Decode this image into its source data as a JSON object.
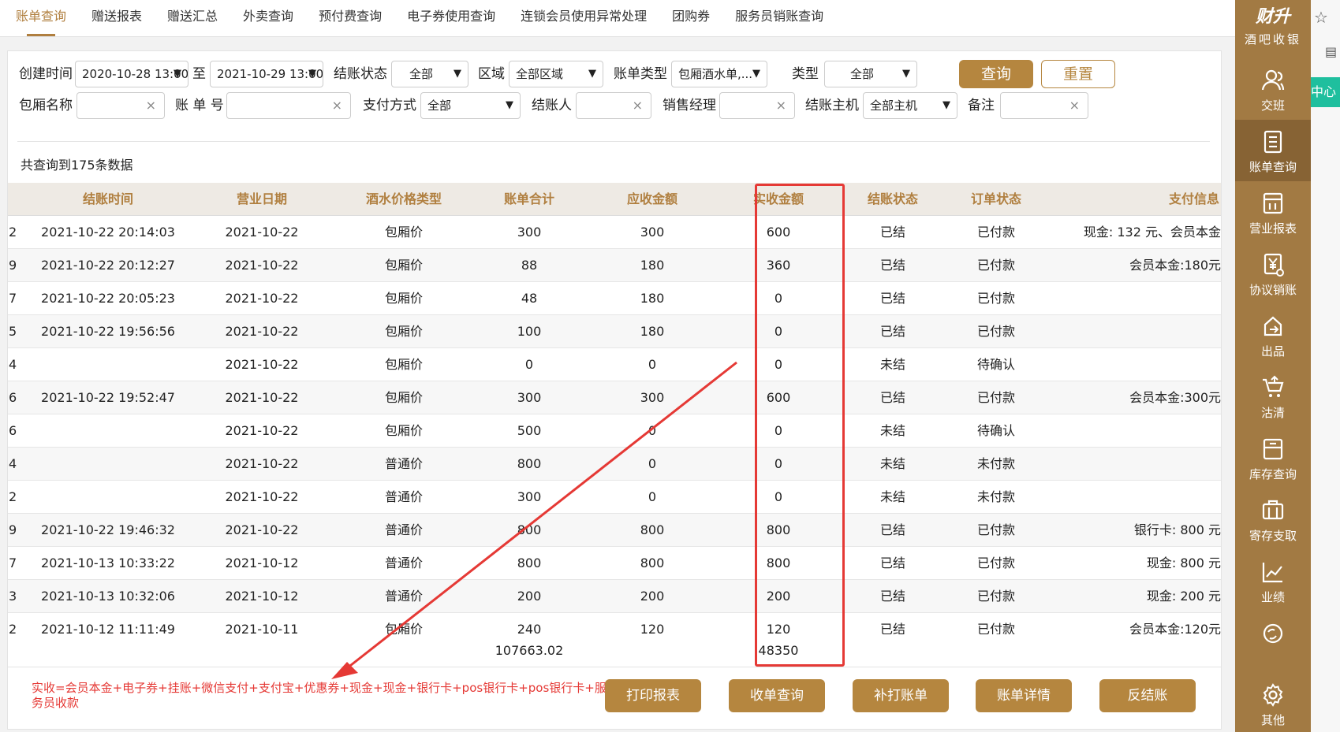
{
  "tabs": [
    "账单查询",
    "赠送报表",
    "赠送汇总",
    "外卖查询",
    "预付费查询",
    "电子券使用查询",
    "连锁会员使用异常处理",
    "团购券",
    "服务员销账查询"
  ],
  "filters": {
    "create_time_label": "创建时间",
    "create_time_from": "2020-10-28 13:00",
    "to_label": "至",
    "create_time_to": "2021-10-29 13:00",
    "settle_status_label": "结账状态",
    "settle_status_value": "全部",
    "area_label": "区域",
    "area_value": "全部区域",
    "bill_type_label": "账单类型",
    "bill_type_value": "包厢酒水单,...",
    "type_label": "类型",
    "type_value": "全部",
    "query_button": "查询",
    "reset_button": "重置",
    "room_name_label": "包厢名称",
    "room_name_value": "",
    "bill_no_label": "账 单 号",
    "bill_no_value": "",
    "pay_method_label": "支付方式",
    "pay_method_value": "全部",
    "settler_label": "结账人",
    "settler_value": "",
    "sales_manager_label": "销售经理",
    "sales_manager_value": "",
    "settle_host_label": "结账主机",
    "settle_host_value": "全部主机",
    "remark_label": "备注",
    "remark_value": "",
    "clear_glyph": "×",
    "caret_glyph": "▼"
  },
  "result_count": "共查询到175条数据",
  "table": {
    "headers": [
      "",
      "结账时间",
      "营业日期",
      "酒水价格类型",
      "账单合计",
      "应收金额",
      "实收金额",
      "结账状态",
      "订单状态",
      "支付信息"
    ],
    "rows": [
      [
        "2",
        "2021-10-22 20:14:03",
        "2021-10-22",
        "包厢价",
        "300",
        "300",
        "600",
        "已结",
        "已付款",
        "现金: 132 元、会员本金"
      ],
      [
        "9",
        "2021-10-22 20:12:27",
        "2021-10-22",
        "包厢价",
        "88",
        "180",
        "360",
        "已结",
        "已付款",
        "会员本金:180元"
      ],
      [
        "7",
        "2021-10-22 20:05:23",
        "2021-10-22",
        "包厢价",
        "48",
        "180",
        "0",
        "已结",
        "已付款",
        ""
      ],
      [
        "5",
        "2021-10-22 19:56:56",
        "2021-10-22",
        "包厢价",
        "100",
        "180",
        "0",
        "已结",
        "已付款",
        ""
      ],
      [
        "4",
        "",
        "2021-10-22",
        "包厢价",
        "0",
        "0",
        "0",
        "未结",
        "待确认",
        ""
      ],
      [
        "6",
        "2021-10-22 19:52:47",
        "2021-10-22",
        "包厢价",
        "300",
        "300",
        "600",
        "已结",
        "已付款",
        "会员本金:300元"
      ],
      [
        "6",
        "",
        "2021-10-22",
        "包厢价",
        "500",
        "0",
        "0",
        "未结",
        "待确认",
        ""
      ],
      [
        "4",
        "",
        "2021-10-22",
        "普通价",
        "800",
        "0",
        "0",
        "未结",
        "未付款",
        ""
      ],
      [
        "2",
        "",
        "2021-10-22",
        "普通价",
        "300",
        "0",
        "0",
        "未结",
        "未付款",
        ""
      ],
      [
        "9",
        "2021-10-22 19:46:32",
        "2021-10-22",
        "普通价",
        "800",
        "800",
        "800",
        "已结",
        "已付款",
        "银行卡: 800 元"
      ],
      [
        "7",
        "2021-10-13 10:33:22",
        "2021-10-12",
        "普通价",
        "800",
        "800",
        "800",
        "已结",
        "已付款",
        "现金: 800 元"
      ],
      [
        "3",
        "2021-10-13 10:32:06",
        "2021-10-12",
        "普通价",
        "200",
        "200",
        "200",
        "已结",
        "已付款",
        "现金: 200 元"
      ],
      [
        "2",
        "2021-10-12 11:11:49",
        "2021-10-11",
        "包厢价",
        "240",
        "120",
        "120",
        "已结",
        "已付款",
        "会员本金:120元"
      ]
    ],
    "totals": {
      "bill_total": "107663.02",
      "received_total": "48350"
    }
  },
  "formula_note": "实收=会员本金+电子券+挂账+微信支付+支付宝+优惠券+现金+现金+银行卡+pos银行卡+pos银行卡+服务员收款",
  "bottom_buttons": [
    "打印报表",
    "收单查询",
    "补打账单",
    "账单详情",
    "反结账"
  ],
  "sidebar": {
    "brand_name": "财升",
    "brand_sub": "酒吧收银",
    "items": [
      {
        "label": "交班",
        "icon": "users-icon"
      },
      {
        "label": "账单查询",
        "icon": "bill-icon"
      },
      {
        "label": "营业报表",
        "icon": "report-icon"
      },
      {
        "label": "协议销账",
        "icon": "yuan-icon"
      },
      {
        "label": "出品",
        "icon": "output-icon"
      },
      {
        "label": "沽清",
        "icon": "cart-icon"
      },
      {
        "label": "库存查询",
        "icon": "inventory-icon"
      },
      {
        "label": "寄存支取",
        "icon": "storage-icon"
      },
      {
        "label": "业绩",
        "icon": "chart-icon"
      },
      {
        "label": "",
        "icon": "support-icon"
      },
      {
        "label": "其他",
        "icon": "gear-icon"
      }
    ]
  },
  "far_right": {
    "center_tab": "中心",
    "star": "☆",
    "grid": "▤"
  },
  "colors": {
    "accent": "#b5863f",
    "sidebar": "#a27a43",
    "highlight": "#e53935",
    "teal": "#1fbf9e"
  }
}
